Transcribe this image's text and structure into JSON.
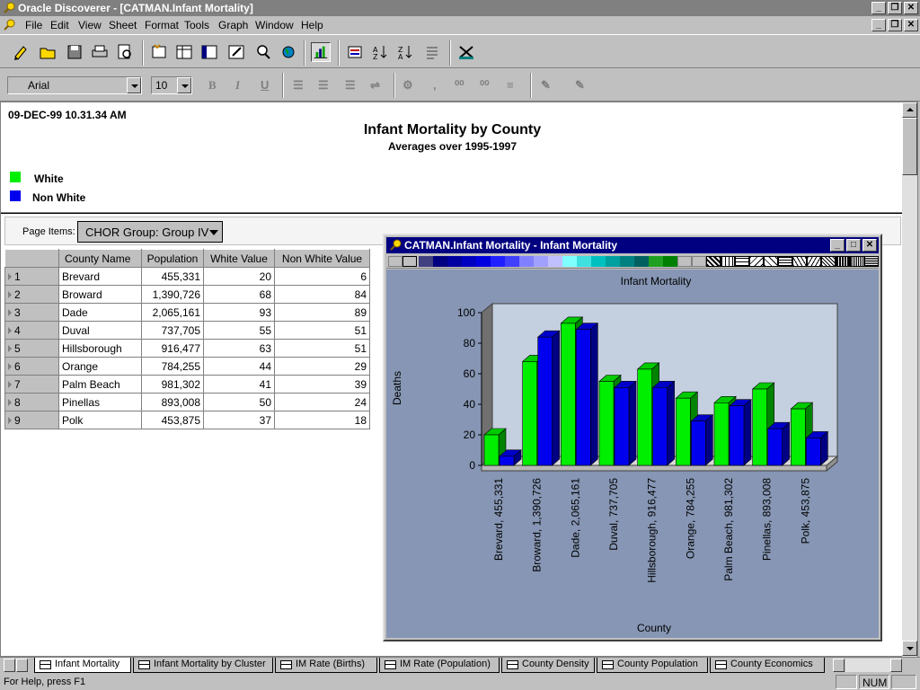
{
  "app": {
    "title": "Oracle Discoverer - [CATMAN.Infant Mortality]"
  },
  "menu": [
    "File",
    "Edit",
    "View",
    "Sheet",
    "Format",
    "Tools",
    "Graph",
    "Window",
    "Help"
  ],
  "format_toolbar": {
    "font_name": "Arial",
    "font_size": "10"
  },
  "report": {
    "datestamp": "09-DEC-99   10.31.34 AM",
    "title": "Infant Mortality by County",
    "subtitle": "Averages over 1995-1997",
    "legend": [
      {
        "label": "White",
        "color": "#00ee00"
      },
      {
        "label": "Non White",
        "color": "#0000ee"
      }
    ]
  },
  "page_items": {
    "label": "Page Items:",
    "value": "CHOR Group: Group IV"
  },
  "table": {
    "headers": [
      "County Name",
      "Population",
      "White Value",
      "Non White Value"
    ],
    "rows": [
      {
        "n": "1",
        "county": "Brevard",
        "population": "455,331",
        "white": "20",
        "nonwhite": "6"
      },
      {
        "n": "2",
        "county": "Broward",
        "population": "1,390,726",
        "white": "68",
        "nonwhite": "84"
      },
      {
        "n": "3",
        "county": "Dade",
        "population": "2,065,161",
        "white": "93",
        "nonwhite": "89"
      },
      {
        "n": "4",
        "county": "Duval",
        "population": "737,705",
        "white": "55",
        "nonwhite": "51"
      },
      {
        "n": "5",
        "county": "Hillsborough",
        "population": "916,477",
        "white": "63",
        "nonwhite": "51"
      },
      {
        "n": "6",
        "county": "Orange",
        "population": "784,255",
        "white": "44",
        "nonwhite": "29"
      },
      {
        "n": "7",
        "county": "Palm Beach",
        "population": "981,302",
        "white": "41",
        "nonwhite": "39"
      },
      {
        "n": "8",
        "county": "Pinellas",
        "population": "893,008",
        "white": "50",
        "nonwhite": "24"
      },
      {
        "n": "9",
        "county": "Polk",
        "population": "453,875",
        "white": "37",
        "nonwhite": "18"
      }
    ]
  },
  "graph_window": {
    "title": "CATMAN.Infant Mortality - Infant Mortality"
  },
  "chart_data": {
    "type": "bar",
    "title": "Infant Mortality",
    "xlabel": "County",
    "ylabel": "Deaths",
    "ylim": [
      0,
      100
    ],
    "yticks": [
      0,
      20,
      40,
      60,
      80,
      100
    ],
    "categories": [
      "Brevard, 455,331",
      "Broward, 1,390,726",
      "Dade, 2,065,161",
      "Duval, 737,705",
      "Hillsborough, 916,477",
      "Orange, 784,255",
      "Palm Beach, 981,302",
      "Pinellas, 893,008",
      "Polk, 453,875"
    ],
    "series": [
      {
        "name": "White",
        "values": [
          20,
          68,
          93,
          55,
          63,
          44,
          41,
          50,
          37
        ],
        "color": "#00ee00"
      },
      {
        "name": "Non White",
        "values": [
          6,
          84,
          89,
          51,
          51,
          29,
          39,
          24,
          18
        ],
        "color": "#0000ee"
      }
    ],
    "grid": false,
    "legend": "none"
  },
  "tabs": [
    {
      "label": "Infant Mortality",
      "active": true
    },
    {
      "label": "Infant Mortality by Cluster",
      "active": false
    },
    {
      "label": "IM Rate (Births)",
      "active": false
    },
    {
      "label": "IM Rate (Population)",
      "active": false
    },
    {
      "label": "County Density",
      "active": false
    },
    {
      "label": "County Population",
      "active": false
    },
    {
      "label": "County Economics",
      "active": false
    }
  ],
  "status": {
    "help_text": "For Help, press F1",
    "num": "NUM"
  }
}
